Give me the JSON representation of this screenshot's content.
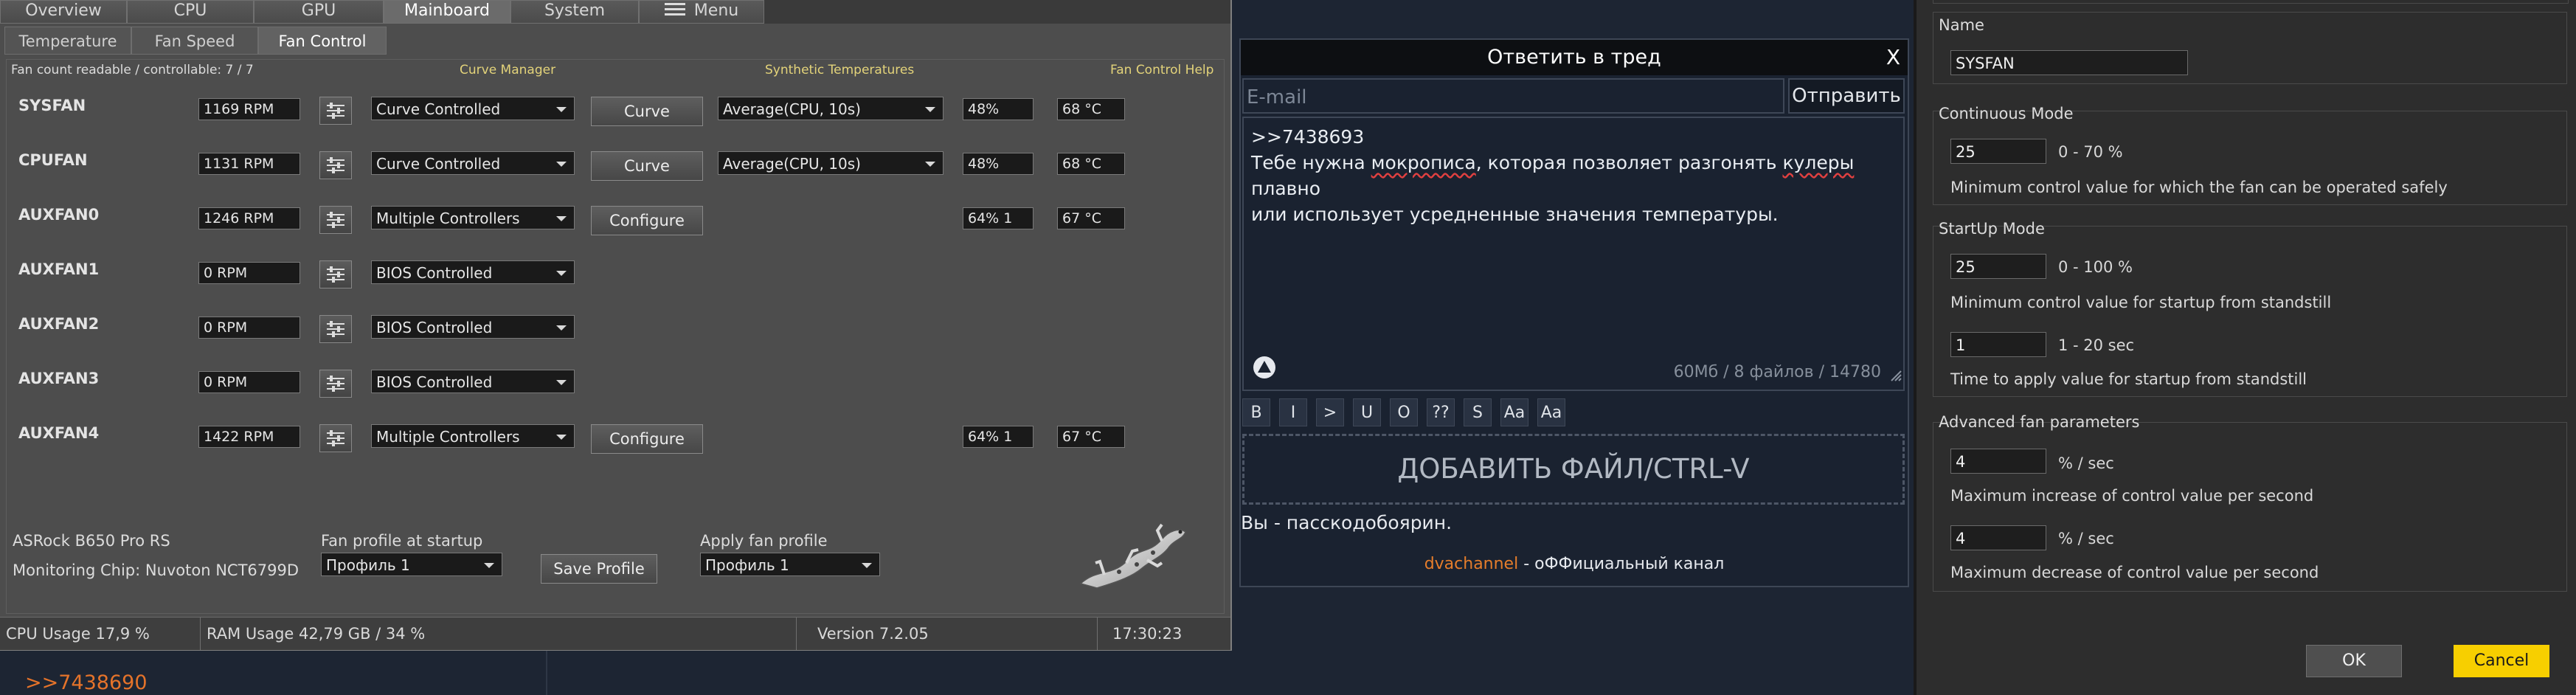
{
  "fan_control": {
    "top_tabs": [
      "Overview",
      "CPU",
      "GPU",
      "Mainboard",
      "System",
      "Menu"
    ],
    "active_top_tab": "Mainboard",
    "sub_tabs": [
      "Temperature",
      "Fan Speed",
      "Fan Control"
    ],
    "active_sub_tab": "Fan Control",
    "fan_count": "Fan count readable / controllable: 7 / 7",
    "headers": {
      "curve_manager": "Curve Manager",
      "synthetic_temperatures": "Synthetic Temperatures",
      "help": "Fan Control Help"
    },
    "fans": [
      {
        "name": "SYSFAN",
        "rpm": "1169 RPM",
        "mode": "Curve Controlled",
        "action": "Curve",
        "synthetic": "Average(CPU, 10s)",
        "percent": "48%",
        "temp": "68 °C"
      },
      {
        "name": "CPUFAN",
        "rpm": "1131 RPM",
        "mode": "Curve Controlled",
        "action": "Curve",
        "synthetic": "Average(CPU, 10s)",
        "percent": "48%",
        "temp": "68 °C"
      },
      {
        "name": "AUXFAN0",
        "rpm": "1246 RPM",
        "mode": "Multiple Controllers",
        "action": "Configure",
        "synthetic": "",
        "percent": "64% 1",
        "temp": "67 °C"
      },
      {
        "name": "AUXFAN1",
        "rpm": "0 RPM",
        "mode": "BIOS Controlled",
        "action": "",
        "synthetic": "",
        "percent": "",
        "temp": ""
      },
      {
        "name": "AUXFAN2",
        "rpm": "0 RPM",
        "mode": "BIOS Controlled",
        "action": "",
        "synthetic": "",
        "percent": "",
        "temp": ""
      },
      {
        "name": "AUXFAN3",
        "rpm": "0 RPM",
        "mode": "BIOS Controlled",
        "action": "",
        "synthetic": "",
        "percent": "",
        "temp": ""
      },
      {
        "name": "AUXFAN4",
        "rpm": "1422 RPM",
        "mode": "Multiple Controllers",
        "action": "Configure",
        "synthetic": "",
        "percent": "64% 1",
        "temp": "67 °C"
      }
    ],
    "board": "ASRock B650 Pro RS",
    "chip": "Monitoring Chip: Nuvoton NCT6799D",
    "profile_at_startup_label": "Fan profile at startup",
    "profile_at_startup_value": "Профиль 1",
    "save_profile": "Save Profile",
    "apply_profile_label": "Apply fan profile",
    "apply_profile_value": "Профиль 1",
    "status": {
      "cpu_usage": "CPU Usage 17,9 %",
      "ram_usage": "RAM Usage 42,79 GB / 34 %",
      "version": "Version 7.2.05",
      "time": "17:30:23"
    }
  },
  "board_background": {
    "post_link": ">>7438690"
  },
  "reply_form": {
    "title": "Ответить в тред",
    "close": "X",
    "email_placeholder": "E-mail",
    "send": "Отправить",
    "message_line1": ">>7438693",
    "message_line2a": "Тебе нужна ",
    "message_misspelled1": "мокрописа",
    "message_line2b": ", которая позволяет разгонять ",
    "message_misspelled2": "кулеры",
    "message_line2c": " плавно",
    "message_line3": "или использует усредненные значения температуры.",
    "file_info": "60Мб / 8 файлов / 14780",
    "format_buttons": [
      "B",
      "I",
      ">",
      "U",
      "O",
      "??",
      "S",
      "Aa",
      "Aa"
    ],
    "add_file": "ДОБАВИТЬ ФАЙЛ/CTRL-V",
    "nickname": "Вы - пасскодобоярин.",
    "channel_link": "dvachannel",
    "channel_text": " - оФФициальный канал"
  },
  "settings": {
    "name_label": "Name",
    "name_value": "SYSFAN",
    "continuous_mode": {
      "title": "Continuous Mode",
      "value": "25",
      "range": "0 - 70 %",
      "description": "Minimum control value for which the fan can be operated safely"
    },
    "startup_mode": {
      "title": "StartUp Mode",
      "value": "25",
      "range": "0 - 100 %",
      "description": "Minimum control value for startup from standstill",
      "time_value": "1",
      "time_range": "1 - 20 sec",
      "time_description": "Time to apply value for startup from standstill"
    },
    "advanced": {
      "title": "Advanced fan parameters",
      "increase_value": "4",
      "increase_unit": "% / sec",
      "increase_description": "Maximum increase of control value per second",
      "decrease_value": "4",
      "decrease_unit": "% / sec",
      "decrease_description": "Maximum decrease of control value per second"
    },
    "ok": "OK",
    "cancel": "Cancel"
  }
}
